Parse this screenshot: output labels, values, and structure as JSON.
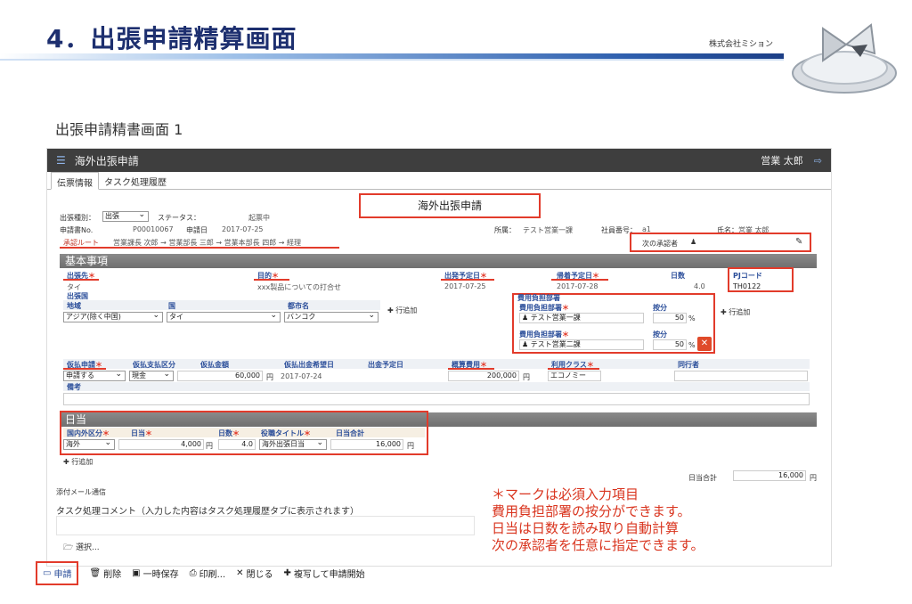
{
  "slide": {
    "title": "4．出張申請精算画面",
    "company": "株式会社ミション",
    "subtitle": "出張申請精書画面 1"
  },
  "app": {
    "window_title": "海外出張申請",
    "user": "営業 太郎",
    "tabs": [
      "伝票情報",
      "タスク処理履歴"
    ],
    "form_title": "海外出張申請"
  },
  "header": {
    "trip_type_label": "出張種別：",
    "trip_type_value": "出張",
    "status_label": "ステータス：",
    "status_value": "起票中",
    "app_no_label": "申請書No.",
    "app_no_value": "P00010067",
    "app_date_label": "申請日",
    "app_date_value": "2017-07-25",
    "dept_label": "所属：",
    "dept_value": "テスト営業一課",
    "emp_no_label": "社員番号：",
    "emp_no_value": "a1",
    "name_label": "氏名：",
    "name_value": "営業 太郎",
    "route_label": "承認ルート",
    "route_value": "営業課長 次郎 → 営業部長 三郎 → 営業本部長 四郎 → 経理",
    "next_approver_label": "次の承認者"
  },
  "basic": {
    "section_title": "基本事項",
    "dest_label": "出張先",
    "dest_value": "タイ",
    "purpose_label": "目的",
    "purpose_value": "xxx製品についての打合せ",
    "depart_label": "出発予定日",
    "depart_value": "2017-07-25",
    "return_label": "帰着予定日",
    "return_value": "2017-07-28",
    "days_label": "日数",
    "days_value": "4.0",
    "pj_label": "PJコード",
    "pj_value": "TH0122",
    "region_header": "出張国",
    "region_col": "地域",
    "country_col": "国",
    "city_col": "都市名",
    "region_value": "アジア(除く中国)",
    "country_value": "タイ",
    "city_value": "バンコク",
    "add_row_label": "行追加",
    "cost_header": "費用負担部署",
    "cost_dept_label": "費用負担部署",
    "ratio_label": "按分",
    "cost_dept1": "テスト営業一課",
    "ratio1": "50",
    "cost_dept2": "テスト営業二課",
    "ratio2": "50",
    "percent": "%",
    "advance_label": "仮払申請",
    "advance_value": "申請する",
    "advance_method_label": "仮払支払区分",
    "advance_method_value": "現金",
    "advance_amount_label": "仮払金額",
    "advance_amount_value": "60,000",
    "yen": "円",
    "advance_date_label": "仮払出金希望日",
    "advance_date_value": "2017-07-24",
    "withdraw_date_label": "出金予定日",
    "budget_label": "概算費用",
    "budget_value": "200,000",
    "class_label": "利用クラス",
    "class_value": "エコノミー",
    "companion_label": "同行者",
    "remarks_label": "備考"
  },
  "daily": {
    "section_title": "日当",
    "type_label": "国内外区分",
    "rate_label": "日当",
    "days_label": "日数",
    "title_label": "役職タイトル",
    "total_label": "日当合計",
    "type_value": "海外",
    "rate_value": "4,000",
    "days_value": "4.0",
    "title_value": "海外出張日当",
    "total_value": "16,000",
    "add_row_label": "行追加",
    "grand_total_label": "日当合計",
    "grand_total_value": "16,000"
  },
  "footer": {
    "mail_label": "添付メール通信",
    "comment_label": "タスク処理コメント（入力した内容はタスク処理履歴タブに表示されます）",
    "select_label": "選択...",
    "toolbar": {
      "apply": "申請",
      "delete": "削除",
      "save_temp": "一時保存",
      "print": "印刷...",
      "close": "閉じる",
      "copy_start": "複写して申請開始"
    }
  },
  "note": [
    "＊マークは必須入力項目",
    "費用負担部署の按分ができます。",
    "日当は日数を読み取り自動計算",
    "次の承認者を任意に指定できます。"
  ],
  "colors": {
    "title_blue": "#1d2f6f",
    "highlight_red": "#e23b2b",
    "section_gray": "#7a7a7a",
    "titlebar_dark": "#3e3e3e"
  }
}
